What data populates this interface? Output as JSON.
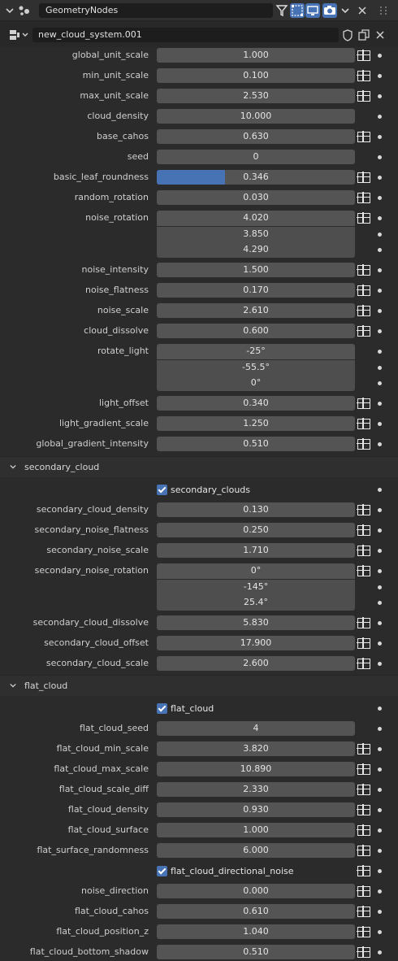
{
  "header": {
    "editor_icon": "properties-editor-icon",
    "panel_name": "GeometryNodes",
    "icons": [
      "modifier-icon",
      "edit-mode-icon",
      "display-viewport-icon",
      "render-camera-icon",
      "chevron-down-icon",
      "close-icon"
    ]
  },
  "datablock": {
    "name": "new_cloud_system.001"
  },
  "colors": {
    "accent": "#4772b3",
    "field": "#545454",
    "panel": "#2b2b2b"
  },
  "params_main": [
    {
      "label": "global_unit_scale",
      "value": "1.000",
      "attr": true
    },
    {
      "label": "min_unit_scale",
      "value": "0.100",
      "attr": true
    },
    {
      "label": "max_unit_scale",
      "value": "2.530",
      "attr": true
    },
    {
      "label": "cloud_density",
      "value": "10.000",
      "attr": false
    },
    {
      "label": "base_cahos",
      "value": "0.630",
      "attr": true
    },
    {
      "label": "seed",
      "value": "0",
      "attr": false
    },
    {
      "label": "basic_leaf_roundness",
      "value": "0.346",
      "attr": true,
      "fill": 0.346
    },
    {
      "label": "random_rotation",
      "value": "0.030",
      "attr": true
    },
    {
      "label": "noise_rotation",
      "values": [
        "4.020",
        "3.850",
        "4.290"
      ],
      "attr": true
    },
    {
      "label": "noise_intensity",
      "value": "1.500",
      "attr": true
    },
    {
      "label": "noise_flatness",
      "value": "0.170",
      "attr": true
    },
    {
      "label": "noise_scale",
      "value": "2.610",
      "attr": true
    },
    {
      "label": "cloud_dissolve",
      "value": "0.600",
      "attr": true
    },
    {
      "label": "rotate_light",
      "values": [
        "-25°",
        "-55.5°",
        "0°"
      ],
      "attr": false
    },
    {
      "label": "light_offset",
      "value": "0.340",
      "attr": true
    },
    {
      "label": "light_gradient_scale",
      "value": "1.250",
      "attr": true
    },
    {
      "label": "global_gradient_intensity",
      "value": "0.510",
      "attr": true
    }
  ],
  "section_secondary": {
    "title": "secondary_cloud",
    "toggle_label": "secondary_clouds",
    "params": [
      {
        "label": "secondary_cloud_density",
        "value": "0.130",
        "attr": true
      },
      {
        "label": "secondary_noise_flatness",
        "value": "0.250",
        "attr": true
      },
      {
        "label": "secondary_noise_scale",
        "value": "1.710",
        "attr": true
      },
      {
        "label": "secondary_noise_rotation",
        "values": [
          "0°",
          "-145°",
          "25.4°"
        ],
        "attr": true
      },
      {
        "label": "secondary_cloud_dissolve",
        "value": "5.830",
        "attr": true
      },
      {
        "label": "secondary_cloud_offset",
        "value": "17.900",
        "attr": true
      },
      {
        "label": "secondary_cloud_scale",
        "value": "2.600",
        "attr": true
      }
    ]
  },
  "section_flat": {
    "title": "flat_cloud",
    "toggle_label": "flat_cloud",
    "params": [
      {
        "label": "flat_cloud_seed",
        "value": "4",
        "attr": false
      },
      {
        "label": "flat_cloud_min_scale",
        "value": "3.820",
        "attr": true
      },
      {
        "label": "flat_cloud_max_scale",
        "value": "10.890",
        "attr": true
      },
      {
        "label": "flat_cloud_scale_diff",
        "value": "2.330",
        "attr": true
      },
      {
        "label": "flat_cloud_density",
        "value": "0.930",
        "attr": true
      },
      {
        "label": "flat_cloud_surface",
        "value": "1.000",
        "attr": true
      },
      {
        "label": "flat_surface_randomness",
        "value": "6.000",
        "attr": true
      }
    ],
    "toggle2_label": "flat_cloud_directional_noise",
    "params2": [
      {
        "label": "noise_direction",
        "value": "0.000",
        "attr": true
      },
      {
        "label": "flat_cloud_cahos",
        "value": "0.610",
        "attr": true
      },
      {
        "label": "flat_cloud_position_z",
        "value": "1.040",
        "attr": true
      },
      {
        "label": "flat_cloud_bottom_shadow",
        "value": "0.510",
        "attr": true
      }
    ]
  }
}
